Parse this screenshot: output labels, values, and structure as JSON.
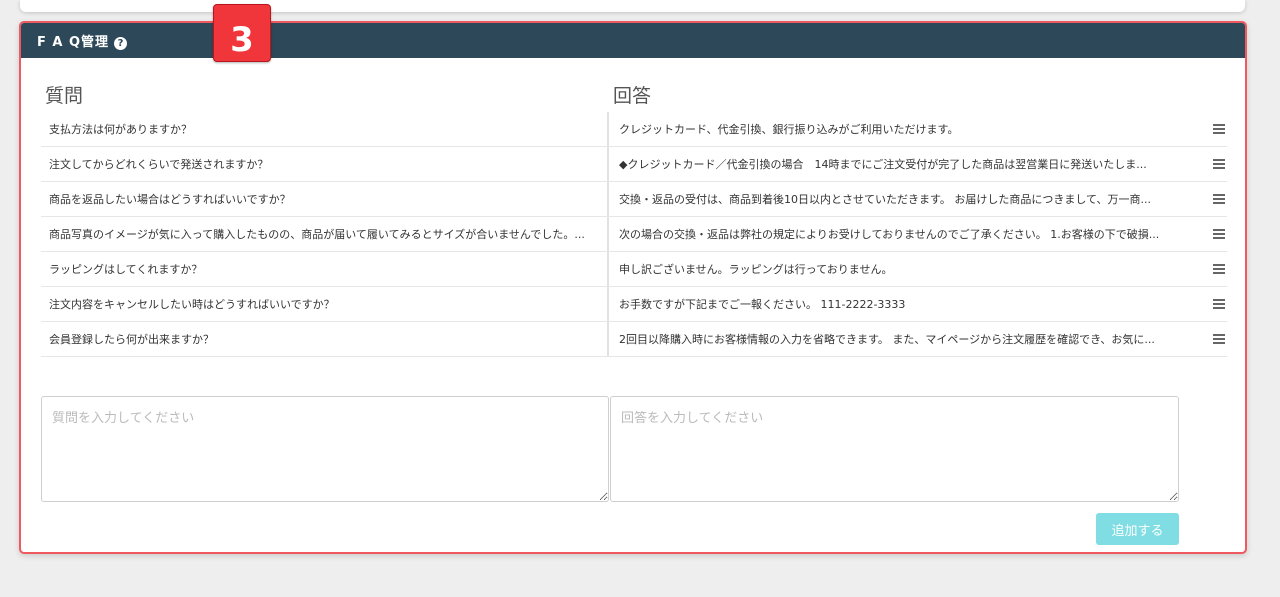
{
  "panel": {
    "title": "F A Q管理",
    "help_icon": "?",
    "step_badge": "3"
  },
  "columns": {
    "question": "質問",
    "answer": "回答"
  },
  "faqs": [
    {
      "q": "支払方法は何がありますか？",
      "a": "クレジットカード、代金引換、銀行振り込みがご利用いただけます。"
    },
    {
      "q": "注文してからどれくらいで発送されますか？",
      "a": "◆クレジットカード／代金引換の場合　14時までにご注文受付が完了した商品は翌営業日に発送いたしま..."
    },
    {
      "q": "商品を返品したい場合はどうすればいいですか？",
      "a": "交換・返品の受付は、商品到着後10日以内とさせていただきます。 お届けした商品につきまして、万一商..."
    },
    {
      "q": "商品写真のイメージが気に入って購入したものの、商品が届いて履いてみるとサイズが合いませんでした。...",
      "a": "次の場合の交換・返品は弊社の規定によりお受けしておりませんのでご了承ください。 1.お客様の下で破損..."
    },
    {
      "q": "ラッピングはしてくれますか？",
      "a": "申し訳ございません。ラッピングは行っておりません。"
    },
    {
      "q": "注文内容をキャンセルしたい時はどうすればいいですか？",
      "a": "お手数ですが下記までご一報ください。 111-2222-3333"
    },
    {
      "q": "会員登録したら何が出来ますか？",
      "a": "2回目以降購入時にお客様情報の入力を省略できます。 また、マイページから注文履歴を確認でき、お気に..."
    }
  ],
  "form": {
    "question_placeholder": "質問を入力してください",
    "answer_placeholder": "回答を入力してください",
    "add_label": "追加する"
  },
  "colors": {
    "header_bg": "#2d4959",
    "panel_border": "#ee5a5f",
    "badge": "#f0353b",
    "add_button": "#7fdde3"
  }
}
